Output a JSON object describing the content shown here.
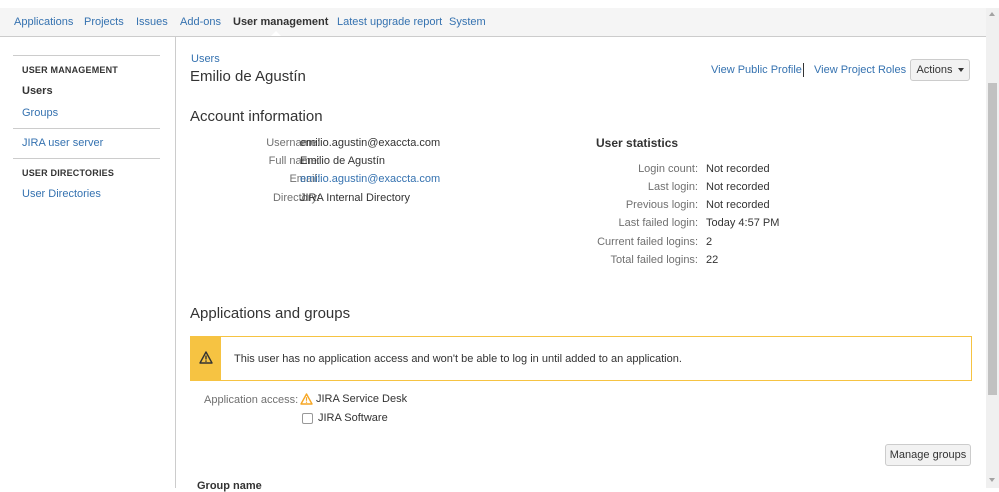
{
  "nav": {
    "tabs": [
      {
        "label": "Applications"
      },
      {
        "label": "Projects"
      },
      {
        "label": "Issues"
      },
      {
        "label": "Add-ons"
      },
      {
        "label": "User management"
      },
      {
        "label": "Latest upgrade report"
      },
      {
        "label": "System"
      }
    ],
    "active_tab": "User management"
  },
  "sidebar": {
    "heading_user_management": "USER MANAGEMENT",
    "link_users": "Users",
    "link_groups": "Groups",
    "link_jira_user_server": "JIRA user server",
    "heading_user_directories": "USER DIRECTORIES",
    "link_user_directories": "User Directories"
  },
  "header": {
    "breadcrumb": "Users",
    "title": "Emilio de Agustín",
    "view_public_profile": "View Public Profile",
    "view_project_roles": "View Project Roles",
    "actions_label": "Actions"
  },
  "account": {
    "heading": "Account information",
    "fields": [
      {
        "label": "Username:",
        "value": "emilio.agustin@exaccta.com"
      },
      {
        "label": "Full name:",
        "value": "Emilio de Agustín"
      },
      {
        "label": "Email:",
        "value": "emilio.agustin@exaccta.com"
      },
      {
        "label": "Directory:",
        "value": "JIRA Internal Directory"
      }
    ]
  },
  "stats": {
    "heading": "User statistics",
    "fields": [
      {
        "label": "Login count:",
        "value": "Not recorded"
      },
      {
        "label": "Last login:",
        "value": "Not recorded"
      },
      {
        "label": "Previous login:",
        "value": "Not recorded"
      },
      {
        "label": "Last failed login:",
        "value": "Today 4:57 PM"
      },
      {
        "label": "Current failed logins:",
        "value": "2"
      },
      {
        "label": "Total failed logins:",
        "value": "22"
      }
    ]
  },
  "applications": {
    "heading": "Applications and groups",
    "warning": "This user has no application access and won't be able to log in until added to an application.",
    "access_label": "Application access:",
    "items": [
      {
        "label": "JIRA Service Desk",
        "icon": "warning-icon"
      },
      {
        "label": "JIRA Software",
        "icon": "checkbox"
      }
    ],
    "manage_groups_label": "Manage groups",
    "group_name_header": "Group name"
  },
  "colors": {
    "link": "#3572b0",
    "warning": "#f6c342",
    "text": "#333333",
    "muted": "#707070"
  }
}
